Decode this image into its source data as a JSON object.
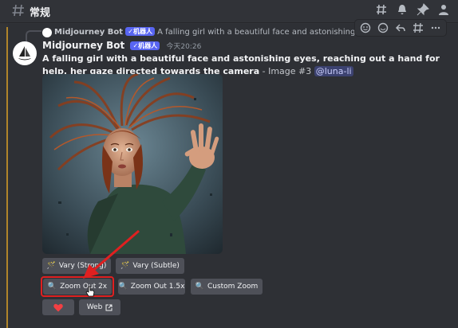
{
  "channel": {
    "name": "常规"
  },
  "reply": {
    "bot_name": "Midjourney Bot",
    "tag": "✓机器人",
    "text": "A falling girl with a beautiful face and astonishing eyes, reaching out a hand for help, her gaze directed towards the camera"
  },
  "message": {
    "author": "Midjourney Bot",
    "tag": "✓机器人",
    "timestamp": "今天20:26",
    "prompt": "A falling girl with a beautiful face and astonishing eyes, reaching out a hand for help, her gaze directed towards the camera",
    "suffix": " - Image #3 ",
    "mention": "@luna-li"
  },
  "buttons": {
    "vary_strong": "Vary (Strong)",
    "vary_subtle": "Vary (Subtle)",
    "zoom_out_2x": "Zoom Out 2x",
    "zoom_out_15x": "Zoom Out 1.5x",
    "custom_zoom": "Custom Zoom",
    "web": "Web"
  },
  "colors": {
    "accent": "#5865f2",
    "highlight": "#e02020",
    "heart": "#f23f43"
  }
}
